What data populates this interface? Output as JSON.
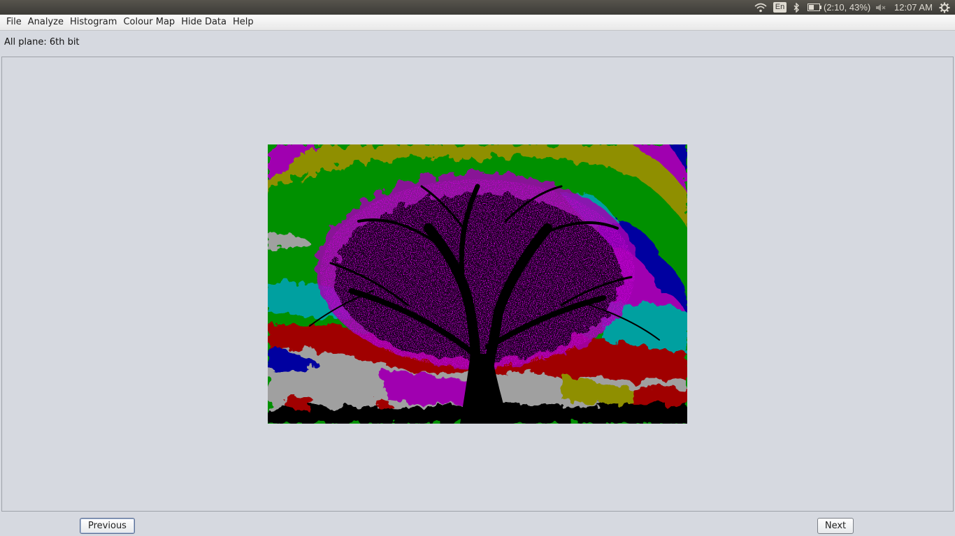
{
  "system_bar": {
    "language": "En",
    "battery": "(2:10, 43%)",
    "time": "12:07 AM",
    "icons": [
      "wifi-icon",
      "bluetooth-icon",
      "battery-icon",
      "volume-muted-icon",
      "settings-gear-icon"
    ]
  },
  "menubar": {
    "items": [
      "File",
      "Analyze",
      "Histogram",
      "Colour Map",
      "Hide Data",
      "Help"
    ]
  },
  "viewer": {
    "plane_label": "All plane: 6th bit",
    "image_colors": {
      "green": "#009000",
      "olive": "#8f8f00",
      "magenta": "#a000b0",
      "blue": "#0000a0",
      "teal": "#00a0a0",
      "red": "#a00000",
      "gray": "#a0a0a0",
      "black": "#000000"
    }
  },
  "buttons": {
    "previous": "Previous",
    "next": "Next"
  }
}
